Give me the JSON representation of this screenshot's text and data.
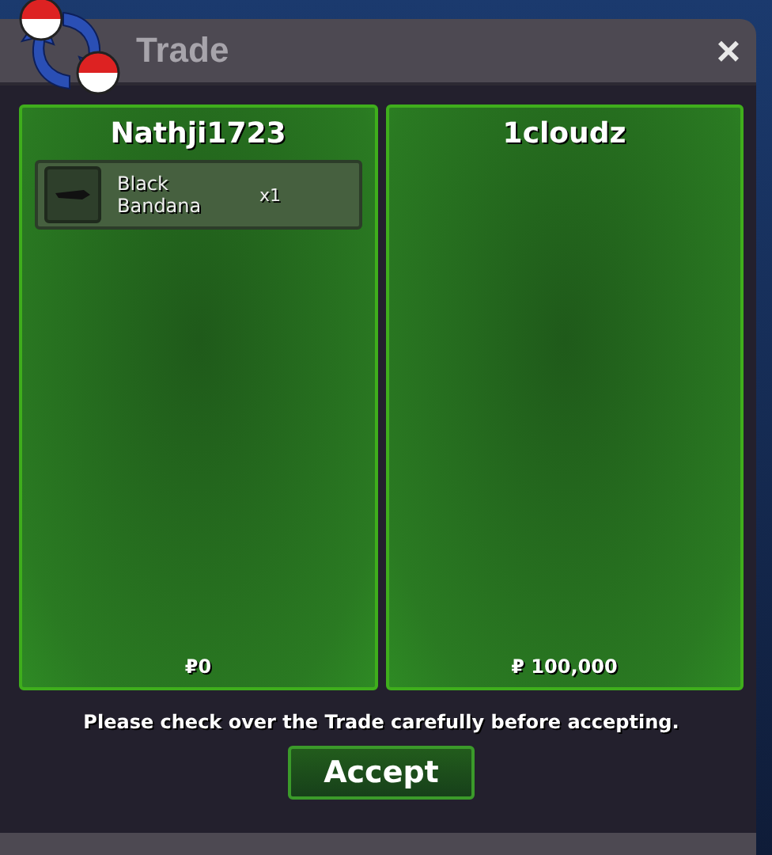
{
  "window": {
    "title": "Trade",
    "close": "×"
  },
  "offers": [
    {
      "trader": "Nathji1723",
      "items": [
        {
          "name": "Black Bandana",
          "quantity": "x1"
        }
      ],
      "money": "₽0"
    },
    {
      "trader": "1cloudz",
      "money": "₽ 100,000"
    }
  ],
  "notice": "Please check over the Trade carefully before accepting.",
  "buttons": [
    "Accept"
  ]
}
